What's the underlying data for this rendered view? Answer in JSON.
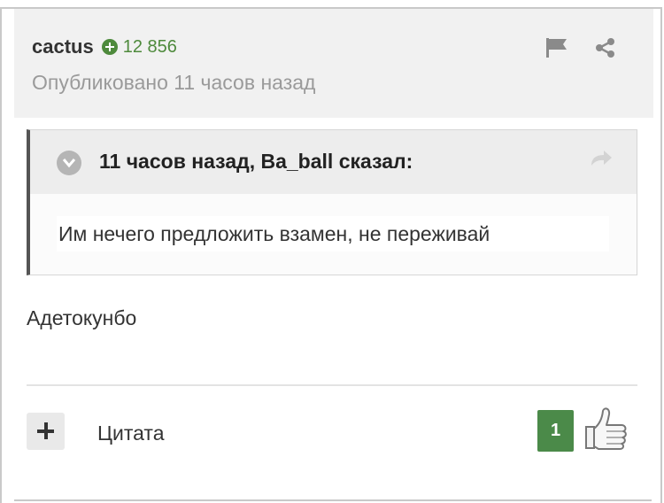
{
  "post": {
    "author": "cactus",
    "reputation": "12 856",
    "published": "Опубликовано 11 часов назад",
    "body_text": "Адетокунбо"
  },
  "quote": {
    "citation": "11 часов назад, Ba_ball сказал:",
    "text": "Им нечего предложить взамен, не переживай"
  },
  "footer": {
    "quote_label": "Цитата",
    "like_count": "1"
  },
  "icons": {
    "reputation": "plus-circle-icon",
    "report": "flag-icon",
    "share": "share-icon",
    "quote_toggle": "chevron-down-icon",
    "quote_link": "forward-arrow-icon",
    "multiquote": "plus-icon",
    "like": "thumbs-up-icon"
  },
  "colors": {
    "header_bg": "#f1f1f1",
    "reputation_green": "#4e8a3c",
    "like_badge": "#4b8a49",
    "quote_border": "#555555"
  }
}
